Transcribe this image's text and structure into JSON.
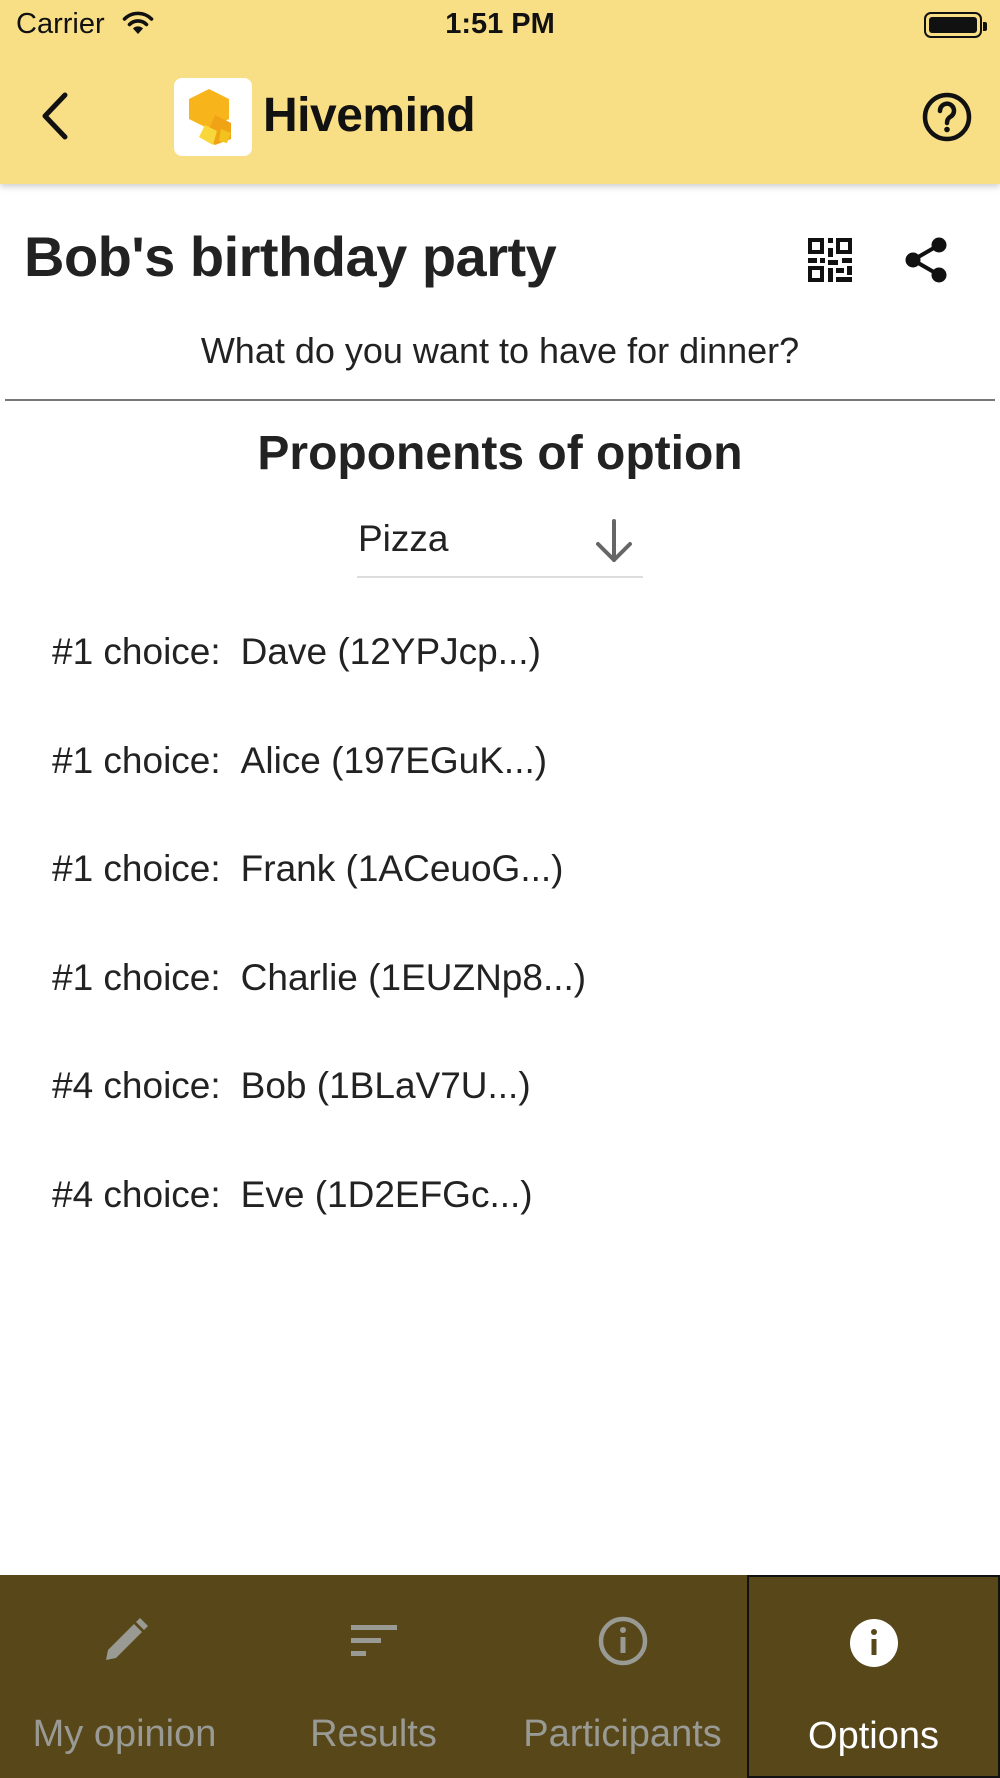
{
  "status_bar": {
    "carrier": "Carrier",
    "time": "1:51 PM"
  },
  "app_bar": {
    "title": "Hivemind",
    "icons": [
      "back-arrow-icon",
      "hivemind-logo-icon",
      "help-icon"
    ]
  },
  "header": {
    "title": "Bob's birthday party",
    "icons": [
      "qr-code-icon",
      "share-icon"
    ]
  },
  "question": "What do you want to have for dinner?",
  "section": {
    "title": "Proponents of option",
    "dropdown": {
      "selected": "Pizza",
      "icon": "arrow-down-icon"
    }
  },
  "proponents": [
    {
      "rank": "#1 choice:",
      "name": "Dave (12YPJcp...)"
    },
    {
      "rank": "#1 choice:",
      "name": "Alice (197EGuK...)"
    },
    {
      "rank": "#1 choice:",
      "name": "Frank (1ACeuoG...)"
    },
    {
      "rank": "#1 choice:",
      "name": "Charlie (1EUZNp8...)"
    },
    {
      "rank": "#4 choice:",
      "name": "Bob (1BLaV7U...)"
    },
    {
      "rank": "#4 choice:",
      "name": "Eve (1D2EFGc...)"
    }
  ],
  "bottom_nav": [
    {
      "label": "My opinion",
      "icon": "pencil-icon",
      "active": false
    },
    {
      "label": "Results",
      "icon": "sort-lines-icon",
      "active": false
    },
    {
      "label": "Participants",
      "icon": "info-outline-icon",
      "active": false
    },
    {
      "label": "Options",
      "icon": "info-filled-icon",
      "active": true
    }
  ],
  "colors": {
    "app_bar": "#f8df86",
    "bottom_nav": "#574719",
    "inactive_nav": "#9a9a95",
    "active_nav": "#ffffff"
  }
}
